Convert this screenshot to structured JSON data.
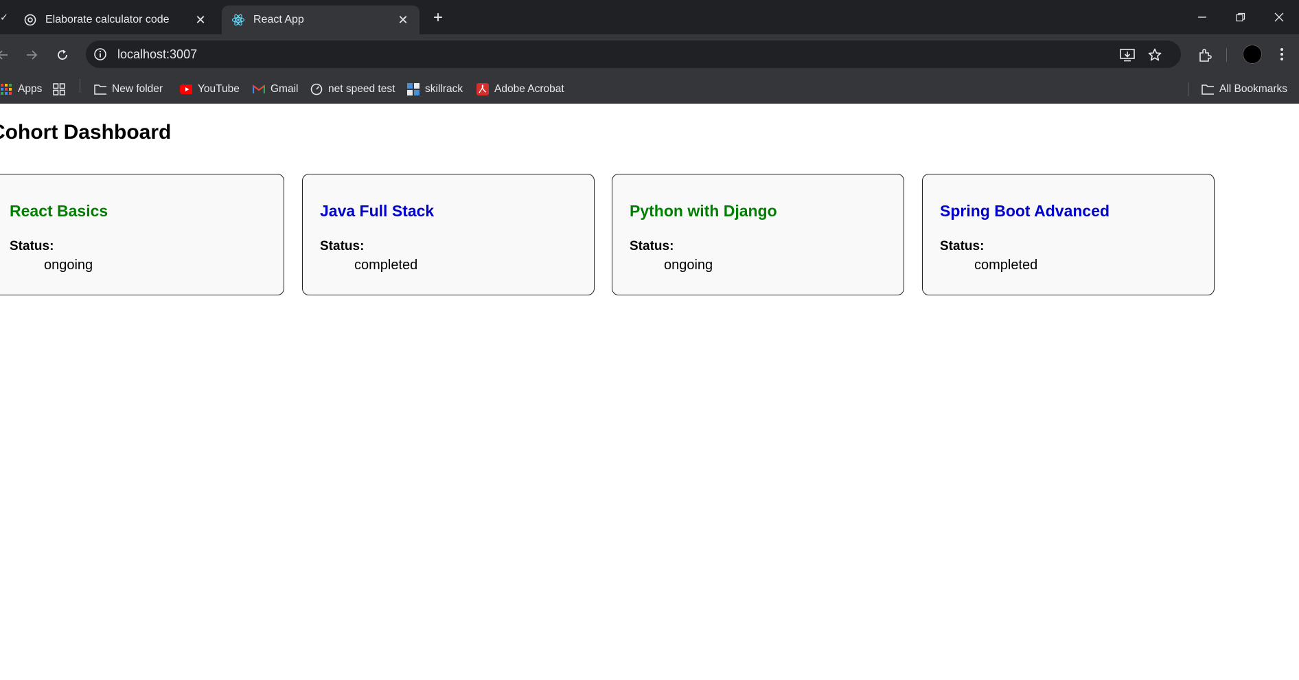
{
  "browser": {
    "tabs": [
      {
        "title": "Elaborate calculator code",
        "favicon": "chatgpt-icon",
        "active": false
      },
      {
        "title": "React App",
        "favicon": "react-icon",
        "active": true
      }
    ],
    "url": "localhost:3007",
    "bookmarks": [
      {
        "label": "Apps",
        "icon": "apps-grid-icon"
      },
      {
        "label": "New folder",
        "icon": "folder-icon"
      },
      {
        "label": "YouTube",
        "icon": "youtube-icon"
      },
      {
        "label": "Gmail",
        "icon": "gmail-icon"
      },
      {
        "label": "net speed test",
        "icon": "speedometer-icon"
      },
      {
        "label": "skillrack",
        "icon": "skillrack-icon"
      },
      {
        "label": "Adobe Acrobat",
        "icon": "acrobat-icon"
      }
    ],
    "all_bookmarks": "All Bookmarks"
  },
  "page": {
    "title": "Cohort Dashboard",
    "status_label": "Status:",
    "cohorts": [
      {
        "name": "React Basics",
        "status": "ongoing",
        "color": "#008000"
      },
      {
        "name": "Java Full Stack",
        "status": "completed",
        "color": "#0000cc"
      },
      {
        "name": "Python with Django",
        "status": "ongoing",
        "color": "#008000"
      },
      {
        "name": "Spring Boot Advanced",
        "status": "completed",
        "color": "#0000cc"
      }
    ]
  }
}
